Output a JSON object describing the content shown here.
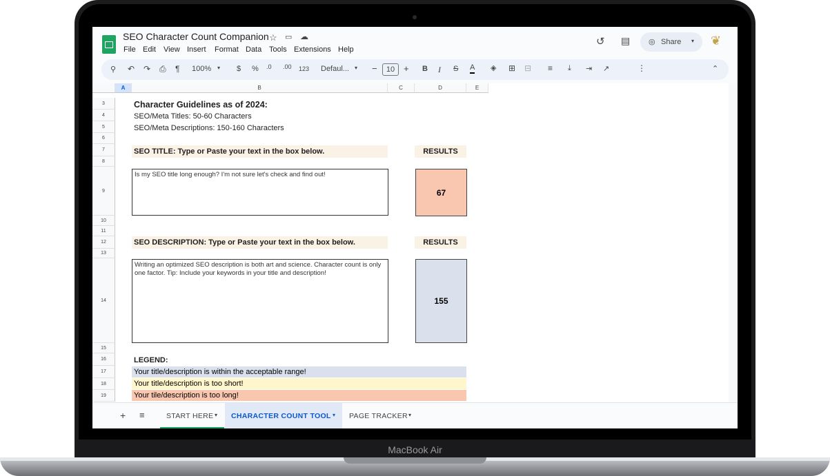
{
  "device": {
    "label": "MacBook Air"
  },
  "app": {
    "title": "SEO Character Count Companion",
    "menu": [
      "File",
      "Edit",
      "View",
      "Insert",
      "Format",
      "Data",
      "Tools",
      "Extensions",
      "Help"
    ],
    "share_label": "Share"
  },
  "toolbar": {
    "zoom": "100%",
    "currency": "$",
    "percent": "%",
    "decrease_decimal": ".0",
    "increase_decimal": ".00",
    "number_format": "123",
    "font": "Defaul...",
    "font_size": "10",
    "bold": "B",
    "italic": "I",
    "text_color": "A"
  },
  "grid": {
    "columns": [
      "A",
      "B",
      "C",
      "D",
      "E"
    ],
    "row_numbers": [
      "3",
      "4",
      "5",
      "6",
      "7",
      "8",
      "9",
      "10",
      "11",
      "12",
      "13",
      "14",
      "15",
      "16",
      "17",
      "18",
      "19"
    ],
    "guidelines_heading": "Character Guidelines as of 2024:",
    "guideline_titles": "SEO/Meta Titles: 50-60 Characters",
    "guideline_descriptions": "SEO/Meta Descriptions: 150-160 Characters",
    "title_banner": "SEO TITLE: Type or Paste your text in the box below.",
    "results_label_1": "RESULTS",
    "title_input": "Is my SEO title long enough? I'm not sure let's check and find out!",
    "title_count": "67",
    "description_banner": "SEO DESCRIPTION: Type or Paste your text in the box below.",
    "results_label_2": "RESULTS",
    "description_input": "Writing an optimized SEO description is both art and science. Character count is only one factor. Tip: Include your keywords in your title and description!",
    "description_count": "155",
    "legend_heading": "LEGEND:",
    "legend": [
      {
        "text": "Your title/description is within the acceptable range!",
        "color": "#dbe1ec"
      },
      {
        "text": "Your title/description is too short!",
        "color": "#fff6cc"
      },
      {
        "text": "Your tile/description is too long!",
        "color": "#f9c6b0"
      }
    ]
  },
  "colors": {
    "title_result": "#f9c6b0",
    "description_result": "#dbe1ec",
    "active_tab": "#0b57d0",
    "sheets_green": "#1ea362"
  },
  "sheets": [
    {
      "label": "START HERE"
    },
    {
      "label": "CHARACTER COUNT TOOL"
    },
    {
      "label": "PAGE TRACKER"
    }
  ]
}
